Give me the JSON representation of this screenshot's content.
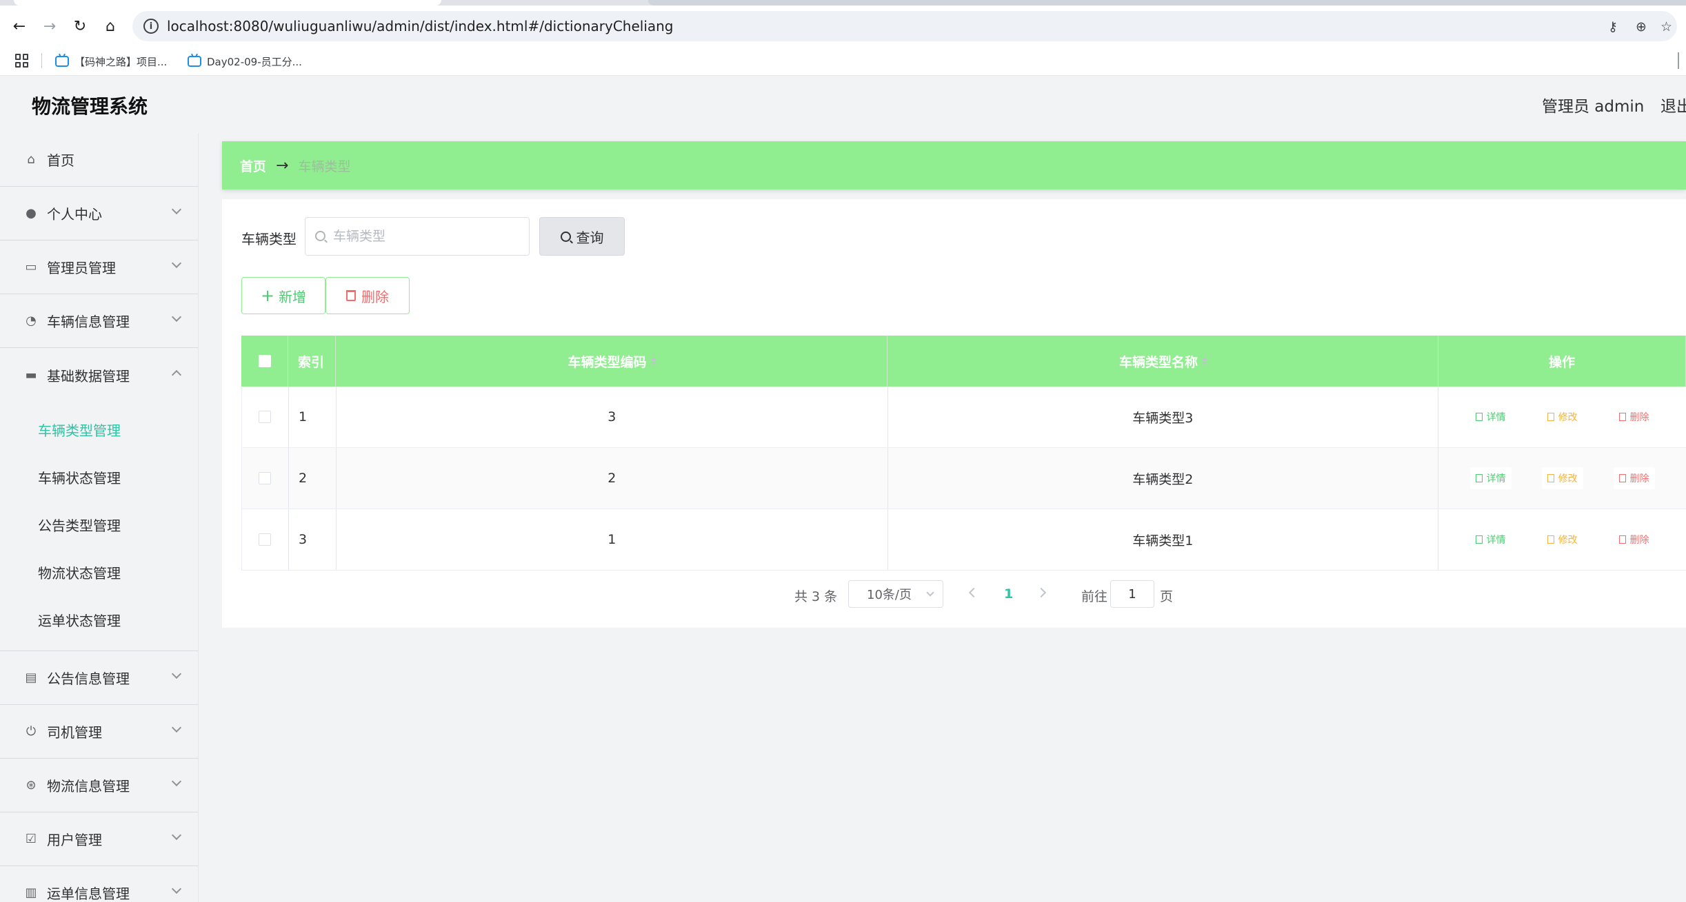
{
  "browser": {
    "url": "localhost:8080/wuliuguanliwu/admin/dist/index.html#/dictionaryCheliang",
    "bookmarks": [
      "【码神之路】项目...",
      "Day02-09-员工分..."
    ]
  },
  "header": {
    "title": "物流管理系统",
    "user": "管理员 admin",
    "logout": "退出"
  },
  "sidebar": {
    "items": [
      {
        "label": "首页",
        "icon": "home-icon"
      },
      {
        "label": "个人中心",
        "icon": "user-icon"
      },
      {
        "label": "管理员管理",
        "icon": "chat-icon"
      },
      {
        "label": "车辆信息管理",
        "icon": "gauge-icon"
      },
      {
        "label": "基础数据管理",
        "icon": "message-icon",
        "expanded": true
      },
      {
        "label": "公告信息管理",
        "icon": "clipboard-icon"
      },
      {
        "label": "司机管理",
        "icon": "power-icon"
      },
      {
        "label": "物流信息管理",
        "icon": "compass-icon"
      },
      {
        "label": "用户管理",
        "icon": "checklist-icon"
      },
      {
        "label": "运单信息管理",
        "icon": "bar-chart-icon"
      }
    ],
    "submenu": [
      "车辆类型管理",
      "车辆状态管理",
      "公告类型管理",
      "物流状态管理",
      "运单状态管理"
    ],
    "active_submenu": "车辆类型管理"
  },
  "breadcrumb": {
    "home": "首页",
    "arrow": "→",
    "current": "车辆类型"
  },
  "search": {
    "label": "车辆类型",
    "placeholder": "车辆类型",
    "button": "查询"
  },
  "actions": {
    "add": "新增",
    "delete": "删除"
  },
  "table": {
    "headers": [
      "索引",
      "车辆类型编码",
      "车辆类型名称",
      "操作"
    ],
    "rows": [
      {
        "index": "1",
        "code": "3",
        "name": "车辆类型3"
      },
      {
        "index": "2",
        "code": "2",
        "name": "车辆类型2"
      },
      {
        "index": "3",
        "code": "1",
        "name": "车辆类型1"
      }
    ],
    "ops": {
      "detail": "详情",
      "edit": "修改",
      "delete": "删除"
    }
  },
  "pagination": {
    "total": "共 3 条",
    "page_size": "10条/页",
    "current": "1",
    "goto": "前往",
    "jump_value": "1",
    "page_suffix": "页"
  },
  "colors": {
    "accent_green": "#90ee90",
    "active_teal": "#2ec4a4",
    "danger": "#f56c6c",
    "warning": "#f5b342"
  }
}
